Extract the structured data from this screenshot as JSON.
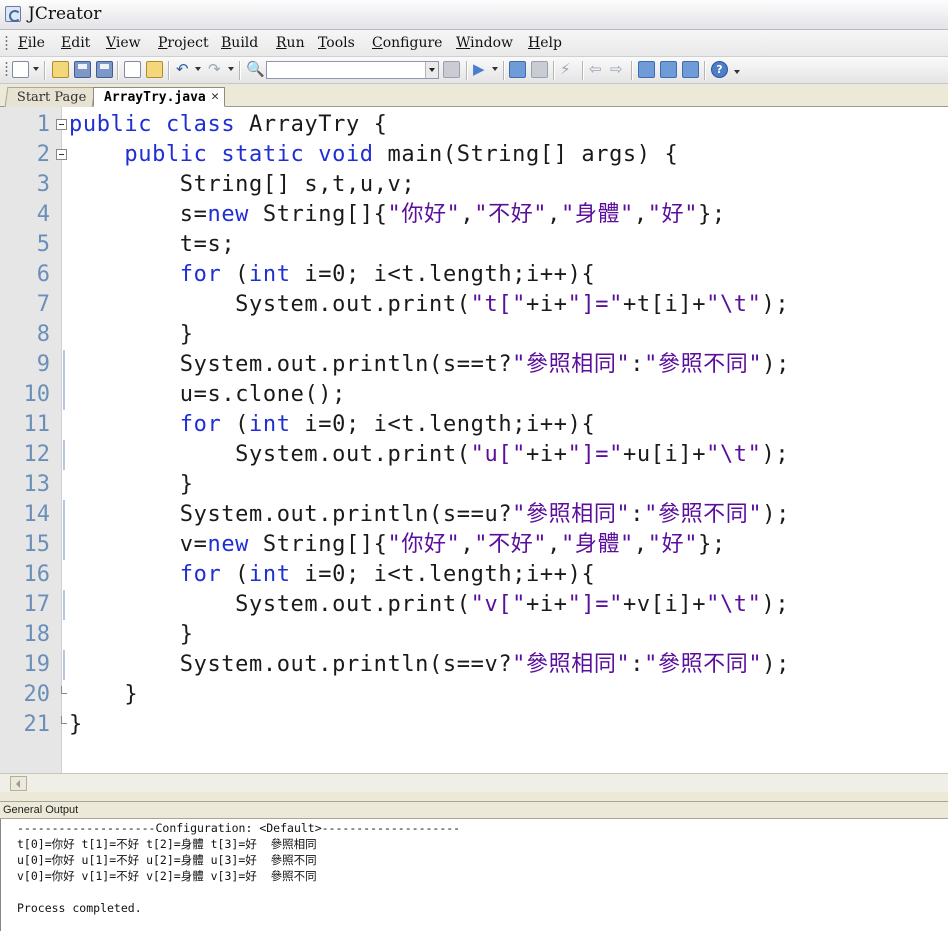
{
  "window": {
    "title": "JCreator"
  },
  "menu": [
    "File",
    "Edit",
    "View",
    "Project",
    "Build",
    "Run",
    "Tools",
    "Configure",
    "Window",
    "Help"
  ],
  "menu_mnemonics": [
    "F",
    "E",
    "V",
    "P",
    "B",
    "R",
    "T",
    "C",
    "W",
    "H"
  ],
  "toolbar": {
    "icons": [
      "new-file-icon",
      "open-folder-icon",
      "save-icon",
      "save-all-icon",
      "copy-icon",
      "paste-icon",
      "undo-icon",
      "redo-icon",
      "find-icon",
      "find-in-files-icon",
      "run-icon",
      "compile-icon",
      "build-icon",
      "lightning-icon",
      "back-icon",
      "forward-icon",
      "window-icon",
      "window-2-icon",
      "window-3-icon",
      "help-icon"
    ],
    "search_value": ""
  },
  "tabs": [
    {
      "label": "Start Page",
      "active": false
    },
    {
      "label": "ArrayTry.java",
      "active": true
    }
  ],
  "editor": {
    "line_numbers": [
      "1",
      "2",
      "3",
      "4",
      "5",
      "6",
      "7",
      "8",
      "9",
      "10",
      "11",
      "12",
      "13",
      "14",
      "15",
      "16",
      "17",
      "18",
      "19",
      "20",
      "21"
    ],
    "lines": [
      "public class ArrayTry {",
      "    public static void main(String[] args) {",
      "        String[] s,t,u,v;",
      "        s=new String[]{\"你好\",\"不好\",\"身體\",\"好\"};",
      "        t=s;",
      "        for (int i=0; i<t.length;i++){",
      "            System.out.print(\"t[\"+i+\"]=\"+t[i]+\"\\t\");",
      "        }",
      "        System.out.println(s==t?\"參照相同\":\"參照不同\");",
      "        u=s.clone();",
      "        for (int i=0; i<t.length;i++){",
      "            System.out.print(\"u[\"+i+\"]=\"+u[i]+\"\\t\");",
      "        }",
      "        System.out.println(s==u?\"參照相同\":\"參照不同\");",
      "        v=new String[]{\"你好\",\"不好\",\"身體\",\"好\"};",
      "        for (int i=0; i<t.length;i++){",
      "            System.out.print(\"v[\"+i+\"]=\"+v[i]+\"\\t\");",
      "        }",
      "        System.out.println(s==v?\"參照相同\":\"參照不同\");",
      "    }",
      "}"
    ]
  },
  "output": {
    "title": "General Output",
    "lines": [
      "--------------------Configuration: <Default>--------------------",
      "t[0]=你好 t[1]=不好 t[2]=身體 t[3]=好  參照相同",
      "u[0]=你好 u[1]=不好 u[2]=身體 u[3]=好  參照不同",
      "v[0]=你好 v[1]=不好 v[2]=身體 v[3]=好  參照不同",
      "",
      "Process completed."
    ]
  },
  "colors": {
    "keyword": "#1f2fd4",
    "string": "#5a0e9b",
    "line_number": "#6b8fb9",
    "gutter": "#e6e6e6"
  }
}
